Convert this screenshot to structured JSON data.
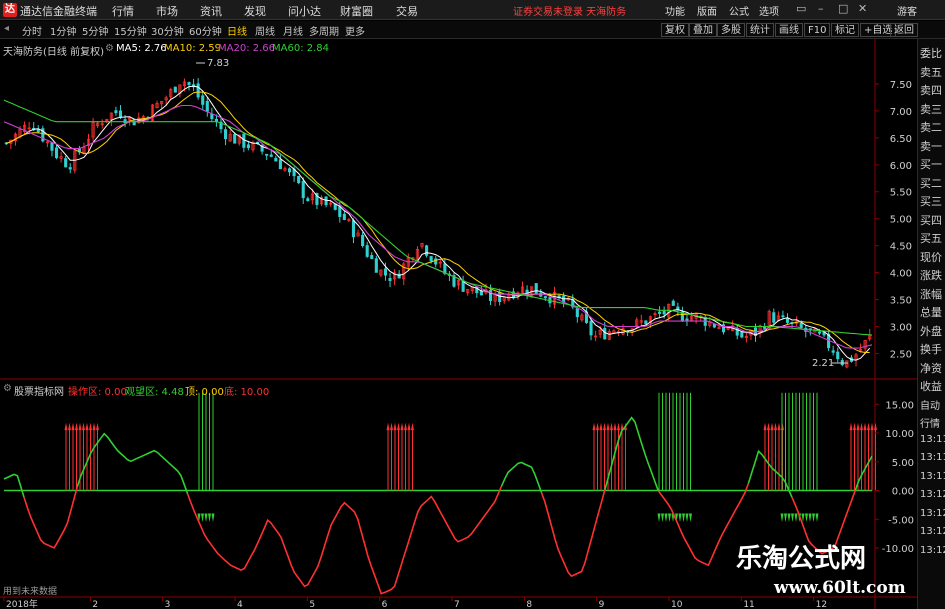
{
  "app": {
    "title": "通达信金融终端",
    "menu": [
      "行情",
      "市场",
      "资讯",
      "发现",
      "问小达",
      "财富圈",
      "交易"
    ],
    "status_warning": "证券交易未登录 天海防务",
    "tools": [
      "功能",
      "版面",
      "公式",
      "选项"
    ],
    "user": "游客"
  },
  "periods": [
    "分时",
    "1分钟",
    "5分钟",
    "15分钟",
    "30分钟",
    "60分钟",
    "日线",
    "周线",
    "月线",
    "多周期",
    "更多"
  ],
  "active_period": "日线",
  "toolbar_buttons": [
    "复权",
    "叠加",
    "多股",
    "统计",
    "画线",
    "F10",
    "标记",
    "+自选",
    "返回"
  ],
  "main_legend": {
    "stock": "天海防务(日线 前复权)",
    "ma5_label": "MA5: 2.76",
    "ma10_label": "MA10: 2.59",
    "ma20_label": "MA20: 2.66",
    "ma60_label": "MA60: 2.84",
    "colors": {
      "ma5": "#ffffff",
      "ma10": "#ffd000",
      "ma20": "#d040d0",
      "ma60": "#30d030",
      "up": "#ff3030",
      "down": "#30d0d0"
    }
  },
  "indicator_legend": {
    "name": "股票指标网",
    "op_zone": "操作区: 0.00",
    "watch_zone": "观望区: 4.48",
    "top": "顶: 0.00",
    "bottom": "底: 10.00"
  },
  "sidepanel": [
    "委比",
    "卖五",
    "卖四",
    "卖三",
    "卖二",
    "卖一",
    "买一",
    "买二",
    "买三",
    "买四",
    "买五",
    "现价",
    "涨跌",
    "涨幅",
    "总量",
    "外盘",
    "换手",
    "净资",
    "收益",
    "自动",
    "行情",
    "13:11",
    "13:11",
    "13:11",
    "13:12",
    "13:12",
    "13:12",
    "13:12"
  ],
  "footnote": "用到未来数据",
  "watermark": {
    "cn": "乐淘公式网",
    "url": "www.60lt.com"
  },
  "chart_data": {
    "type": "candlestick",
    "price_axis": {
      "ticks": [
        7.5,
        7.0,
        6.5,
        6.0,
        5.5,
        5.0,
        4.5,
        4.0,
        3.5,
        3.0,
        2.5
      ],
      "labels": [
        "7.50",
        "7.00",
        "6.50",
        "6.00",
        "5.50",
        "5.00",
        "4.50",
        "4.00",
        "3.50",
        "3.00",
        "2.50"
      ],
      "range": [
        2.1,
        8.0
      ]
    },
    "annotations": {
      "high": "7.83",
      "low": "2.21"
    },
    "x_labels": [
      "2018年",
      "2",
      "3",
      "4",
      "5",
      "6",
      "7",
      "8",
      "9",
      "10",
      "11",
      "12"
    ],
    "price_closes": [
      6.4,
      6.6,
      6.8,
      6.5,
      6.2,
      6.0,
      6.3,
      6.7,
      6.9,
      7.0,
      6.8,
      6.9,
      7.1,
      7.3,
      7.6,
      7.4,
      7.0,
      6.7,
      6.5,
      6.4,
      6.3,
      6.2,
      6.0,
      5.7,
      5.4,
      5.3,
      5.2,
      5.0,
      4.7,
      4.3,
      4.0,
      3.9,
      4.2,
      4.6,
      4.3,
      4.0,
      3.8,
      3.7,
      3.6,
      3.5,
      3.6,
      3.7,
      3.7,
      3.6,
      3.5,
      3.4,
      3.1,
      2.8,
      2.9,
      3.0,
      3.0,
      3.1,
      3.2,
      3.3,
      3.2,
      3.2,
      3.1,
      3.0,
      2.9,
      2.8,
      2.9,
      3.2,
      3.1,
      3.0,
      2.9,
      2.8,
      2.6,
      2.3,
      2.5,
      2.8
    ],
    "ma60": [
      7.2,
      7.1,
      7.0,
      6.9,
      6.8,
      6.8,
      6.8,
      6.8,
      6.8,
      6.8,
      6.8,
      6.8,
      6.8,
      6.8,
      6.8,
      6.8,
      6.8,
      6.8,
      6.7,
      6.6,
      6.5,
      6.4,
      6.2,
      6.0,
      5.8,
      5.6,
      5.4,
      5.3,
      5.1,
      4.9,
      4.7,
      4.5,
      4.3,
      4.2,
      4.1,
      4.0,
      3.9,
      3.8,
      3.75,
      3.7,
      3.65,
      3.6,
      3.55,
      3.5,
      3.45,
      3.4,
      3.35,
      3.35,
      3.35,
      3.35,
      3.35,
      3.35,
      3.3,
      3.3,
      3.25,
      3.2,
      3.15,
      3.1,
      3.05,
      3.0,
      3.0,
      3.0,
      2.98,
      2.96,
      2.94,
      2.92,
      2.9,
      2.88,
      2.86,
      2.84
    ],
    "ma20": [
      6.8,
      6.7,
      6.6,
      6.5,
      6.4,
      6.3,
      6.3,
      6.4,
      6.5,
      6.7,
      6.8,
      6.8,
      6.9,
      7.0,
      7.1,
      7.1,
      7.0,
      6.9,
      6.8,
      6.6,
      6.5,
      6.3,
      6.2,
      6.0,
      5.8,
      5.6,
      5.4,
      5.2,
      5.0,
      4.7,
      4.5,
      4.3,
      4.2,
      4.2,
      4.1,
      4.0,
      3.9,
      3.8,
      3.7,
      3.6,
      3.6,
      3.6,
      3.6,
      3.6,
      3.5,
      3.4,
      3.3,
      3.1,
      3.0,
      3.0,
      3.0,
      3.0,
      3.1,
      3.1,
      3.1,
      3.1,
      3.1,
      3.0,
      3.0,
      2.9,
      2.9,
      3.0,
      3.0,
      3.0,
      2.9,
      2.8,
      2.7,
      2.6,
      2.6,
      2.66
    ],
    "indicator_axis": {
      "ticks": [
        15,
        10,
        5,
        0,
        -5,
        -10
      ],
      "labels": [
        "15.00",
        "10.00",
        "5.00",
        "0.00",
        "-5.00",
        "-10.00"
      ],
      "range": [
        -18,
        18
      ]
    },
    "indicator_values": [
      2,
      3,
      -4,
      -9,
      -10,
      -6,
      2,
      7,
      10,
      7,
      5,
      6,
      7,
      5,
      3,
      -3,
      -8,
      -11,
      -13,
      -14,
      -10,
      -5,
      -8,
      -14,
      -17,
      -13,
      -6,
      -2,
      -4,
      -12,
      -18,
      -17,
      -10,
      -3,
      -1,
      -5,
      -9,
      -8,
      -5,
      -2,
      3,
      5,
      4,
      -2,
      -10,
      -15,
      -14,
      -6,
      2,
      10,
      13,
      6,
      0,
      -3,
      -8,
      -12,
      -13,
      -8,
      -4,
      0,
      7,
      4,
      2,
      -3,
      -9,
      -11,
      -10,
      -4,
      2,
      6
    ],
    "red_arrow_zones": [
      [
        66,
        100
      ],
      [
        388,
        415
      ],
      [
        594,
        626
      ],
      [
        765,
        785
      ],
      [
        851,
        876
      ]
    ],
    "green_arrow_zones": [
      [
        199,
        214
      ],
      [
        659,
        691
      ],
      [
        782,
        820
      ]
    ]
  }
}
